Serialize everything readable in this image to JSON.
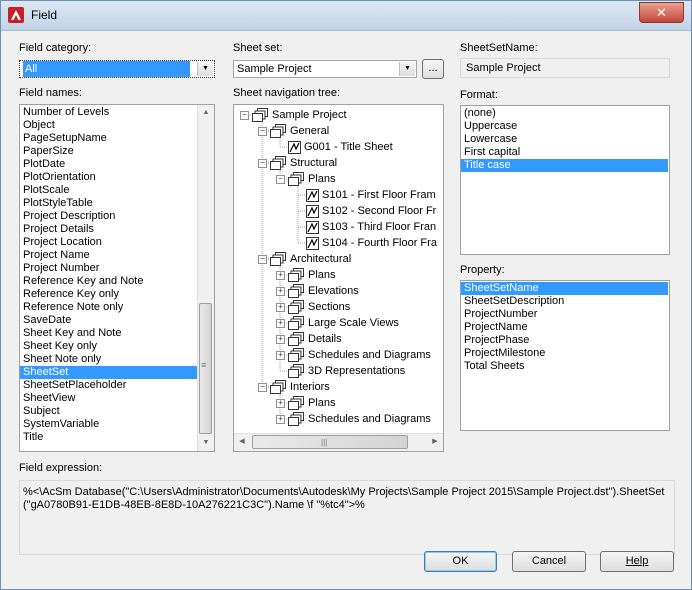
{
  "window": {
    "title": "Field",
    "close_glyph": "✕"
  },
  "labels": {
    "field_category": "Field category:",
    "field_names": "Field names:",
    "sheet_set": "Sheet set:",
    "sheet_nav_tree": "Sheet navigation tree:",
    "sheetsetname": "SheetSetName:",
    "format": "Format:",
    "property": "Property:",
    "field_expression": "Field expression:"
  },
  "field_category": {
    "value": "All"
  },
  "field_names": {
    "items": [
      "Number of Levels",
      "Object",
      "PageSetupName",
      "PaperSize",
      "PlotDate",
      "PlotOrientation",
      "PlotScale",
      "PlotStyleTable",
      "Project Description",
      "Project Details",
      "Project Location",
      "Project Name",
      "Project Number",
      "Reference Key and Note",
      "Reference Key only",
      "Reference Note only",
      "SaveDate",
      "Sheet Key and Note",
      "Sheet Key only",
      "Sheet Note only",
      "SheetSet",
      "SheetSetPlaceholder",
      "SheetView",
      "Subject",
      "SystemVariable",
      "Title"
    ],
    "selected": "SheetSet"
  },
  "sheet_set": {
    "value": "Sample Project",
    "browse_label": "..."
  },
  "tree": [
    {
      "label": "Sample Project",
      "level": 0,
      "kind": "set",
      "exp": "-"
    },
    {
      "label": "General",
      "level": 1,
      "kind": "subset",
      "exp": "-"
    },
    {
      "label": "G001 - Title Sheet",
      "level": 2,
      "kind": "sheet",
      "exp": ""
    },
    {
      "label": "Structural",
      "level": 1,
      "kind": "subset",
      "exp": "-"
    },
    {
      "label": "Plans",
      "level": 2,
      "kind": "subset",
      "exp": "-"
    },
    {
      "label": "S101 - First Floor Fram",
      "level": 3,
      "kind": "sheet",
      "exp": ""
    },
    {
      "label": "S102 - Second Floor Fr",
      "level": 3,
      "kind": "sheet",
      "exp": ""
    },
    {
      "label": "S103 - Third Floor Fran",
      "level": 3,
      "kind": "sheet",
      "exp": ""
    },
    {
      "label": "S104 - Fourth Floor Fra",
      "level": 3,
      "kind": "sheet",
      "exp": ""
    },
    {
      "label": "Architectural",
      "level": 1,
      "kind": "subset",
      "exp": "-"
    },
    {
      "label": "Plans",
      "level": 2,
      "kind": "subset",
      "exp": "+"
    },
    {
      "label": "Elevations",
      "level": 2,
      "kind": "subset",
      "exp": "+"
    },
    {
      "label": "Sections",
      "level": 2,
      "kind": "subset",
      "exp": "+"
    },
    {
      "label": "Large Scale Views",
      "level": 2,
      "kind": "subset",
      "exp": "+"
    },
    {
      "label": "Details",
      "level": 2,
      "kind": "subset",
      "exp": "+"
    },
    {
      "label": "Schedules and Diagrams",
      "level": 2,
      "kind": "subset",
      "exp": "+"
    },
    {
      "label": "3D Representations",
      "level": 2,
      "kind": "subset",
      "exp": ""
    },
    {
      "label": "Interiors",
      "level": 1,
      "kind": "subset",
      "exp": "-"
    },
    {
      "label": "Plans",
      "level": 2,
      "kind": "subset",
      "exp": "+"
    },
    {
      "label": "Schedules and Diagrams",
      "level": 2,
      "kind": "subset",
      "exp": "+"
    }
  ],
  "sheetsetname_value": "Sample Project",
  "format": {
    "items": [
      "(none)",
      "Uppercase",
      "Lowercase",
      "First capital",
      "Title case"
    ],
    "selected": "Title case"
  },
  "property": {
    "items": [
      "SheetSetName",
      "SheetSetDescription",
      "ProjectNumber",
      "ProjectName",
      "ProjectPhase",
      "ProjectMilestone",
      "Total Sheets"
    ],
    "selected": "SheetSetName"
  },
  "field_expression": "%<\\AcSm Database(\"C:\\Users\\Administrator\\Documents\\Autodesk\\My Projects\\Sample Project 2015\\Sample Project.dst\").SheetSet(\"gA0780B91-E1DB-48EB-8E8D-10A276221C3C\").Name \\f \"%tc4\">%",
  "buttons": {
    "ok": "OK",
    "cancel": "Cancel",
    "help": "Help"
  },
  "scroll": {
    "up": "▲",
    "down": "▼",
    "left": "◀",
    "right": "▶",
    "grip": "|||",
    "vgrip": "≡"
  },
  "colors": {
    "selection": "#3399ff",
    "accent_red": "#c6453a"
  }
}
